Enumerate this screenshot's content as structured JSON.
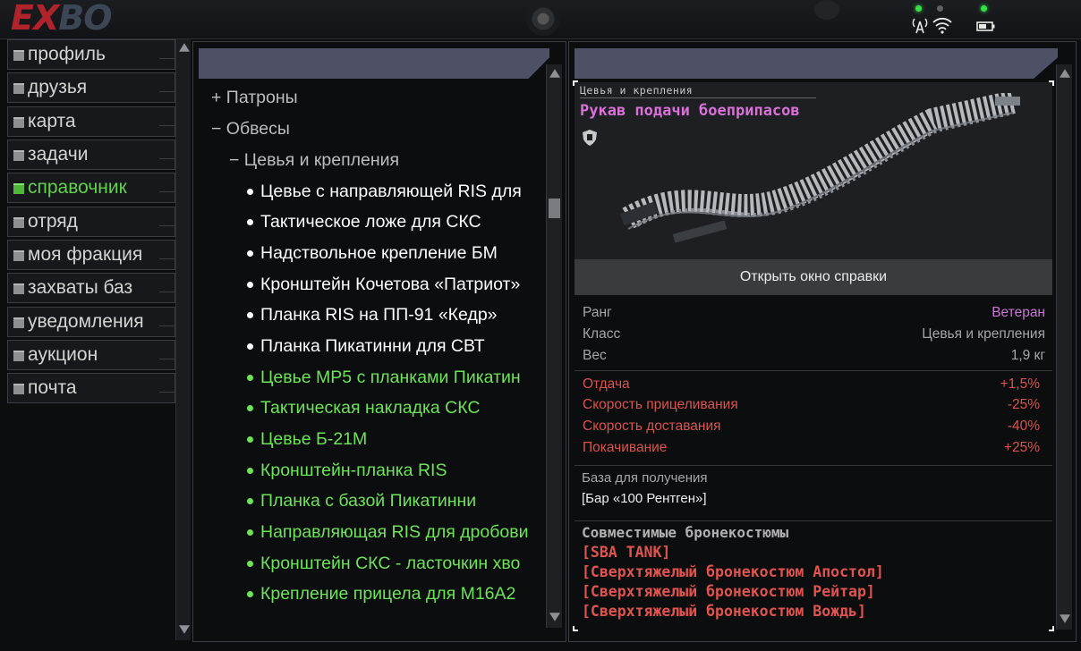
{
  "app": {
    "logo_left": "EX",
    "logo_right": "BO"
  },
  "menu": [
    {
      "label": "профиль",
      "active": false
    },
    {
      "label": "друзья",
      "active": false
    },
    {
      "label": "карта",
      "active": false
    },
    {
      "label": "задачи",
      "active": false
    },
    {
      "label": "справочник",
      "active": true
    },
    {
      "label": "отряд",
      "active": false
    },
    {
      "label": "моя фракция",
      "active": false
    },
    {
      "label": "захваты баз",
      "active": false
    },
    {
      "label": "уведомления",
      "active": false
    },
    {
      "label": "аукцион",
      "active": false
    },
    {
      "label": "почта",
      "active": false
    }
  ],
  "tree": {
    "categories": [
      {
        "label": "+ Патроны",
        "level": 0
      },
      {
        "label": "− Обвесы",
        "level": 0
      },
      {
        "label": "− Цевья и крепления",
        "level": 1
      }
    ],
    "items": [
      {
        "label": "Цевье с направляющей RIS для",
        "color": "white"
      },
      {
        "label": "Тактическое ложе для СКС",
        "color": "white"
      },
      {
        "label": "Надствольное крепление БМ",
        "color": "white"
      },
      {
        "label": "Кронштейн Кочетова «Патриот»",
        "color": "white"
      },
      {
        "label": "Планка RIS на ПП-91 «Кедр»",
        "color": "white"
      },
      {
        "label": "Планка Пикатинни для СВТ",
        "color": "white"
      },
      {
        "label": "Цевье MP5 с планками Пикатин",
        "color": "green"
      },
      {
        "label": "Тактическая накладка СКС",
        "color": "green"
      },
      {
        "label": "Цевье Б-21М",
        "color": "green"
      },
      {
        "label": "Кронштейн-планка RIS",
        "color": "green"
      },
      {
        "label": "Планка с базой Пикатинни",
        "color": "green"
      },
      {
        "label": "Направляющая RIS для дробови",
        "color": "green"
      },
      {
        "label": "Кронштейн СКС - ласточкин хво",
        "color": "green"
      },
      {
        "label": "Крепление прицела для M16A2",
        "color": "green"
      }
    ]
  },
  "detail": {
    "category": "Цевья и крепления",
    "title": "Рукав подачи боеприпасов",
    "open_button": "Открыть окно справки",
    "stats": [
      {
        "label": "Ранг",
        "value": "Ветеран"
      },
      {
        "label": "Класс",
        "value": "Цевья и крепления"
      },
      {
        "label": "Вес",
        "value": "1,9 кг"
      }
    ],
    "modifiers": [
      {
        "label": "Отдача",
        "value": "+1,5%"
      },
      {
        "label": "Скорость прицеливания",
        "value": "-25%"
      },
      {
        "label": "Скорость доставания",
        "value": "-40%"
      },
      {
        "label": "Покачивание",
        "value": "+25%"
      }
    ],
    "base_label": "База для получения",
    "base_value": "[Бар «100 Рентген»]",
    "compat_title": "Совместимые бронекостюмы",
    "compat": [
      "[SBA TANK]",
      "[Сверхтяжелый бронекостюм Апостол]",
      "[Сверхтяжелый бронекостюм Рейтар]",
      "[Сверхтяжелый бронекостюм Вождь]"
    ]
  },
  "colors": {
    "active_menu": "#62d14c",
    "green_item": "#6ee35a",
    "rank": "#c778d2",
    "modifier": "#d9534f",
    "header_bar": "#4e5166"
  }
}
